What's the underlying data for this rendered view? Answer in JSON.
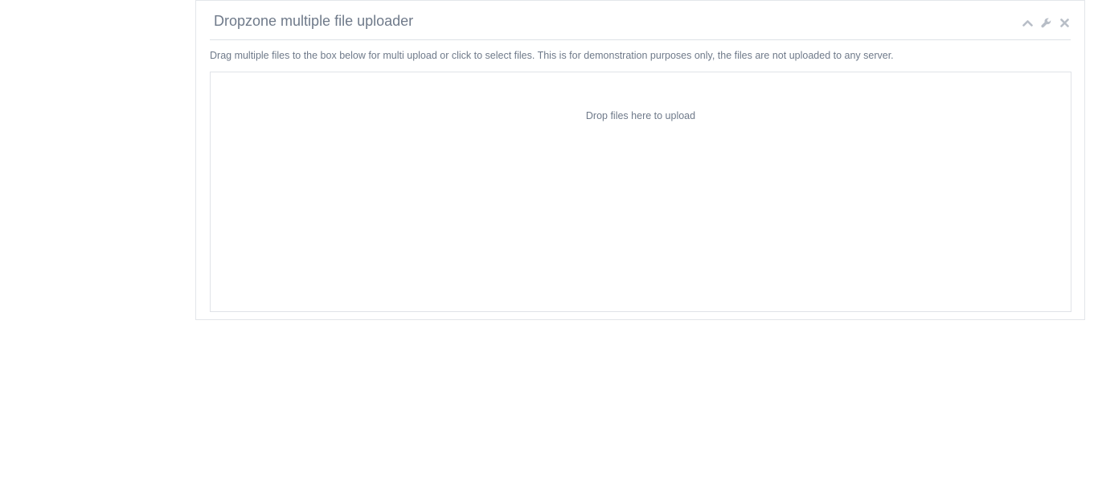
{
  "panel": {
    "title": "Dropzone multiple file uploader",
    "tools": [
      {
        "icon": "chevron-up-icon"
      },
      {
        "icon": "wrench-icon"
      },
      {
        "icon": "close-icon"
      }
    ],
    "description": "Drag multiple files to the box below for multi upload or click to select files. This is for demonstration purposes only, the files are not uploaded to any server."
  },
  "dropzone": {
    "message": "Drop files here to upload"
  },
  "colors": {
    "text": "#6f7a8a",
    "icon": "#b8bec7",
    "border": "#e0e3e8"
  }
}
